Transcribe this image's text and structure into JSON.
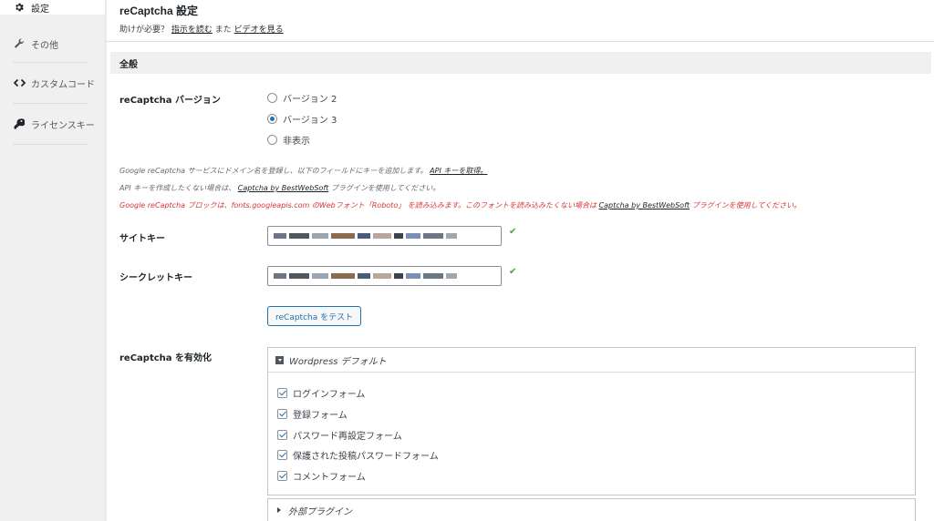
{
  "sidebar": {
    "items": [
      {
        "label": "設定",
        "icon": "gear-icon"
      },
      {
        "label": "その他",
        "icon": "wrench-icon"
      },
      {
        "label": "カスタムコード",
        "icon": "code-icon"
      },
      {
        "label": "ライセンスキー",
        "icon": "key-icon"
      }
    ]
  },
  "header": {
    "title": "reCaptcha 設定",
    "help_prefix": "助けが必要？",
    "help_link1": "指示を読む",
    "help_mid": "また",
    "help_link2": "ビデオを見る"
  },
  "section": {
    "title": "全般"
  },
  "version": {
    "label": "reCaptcha バージョン",
    "options": [
      "バージョン 2",
      "バージョン 3",
      "非表示"
    ],
    "selected": "バージョン 3"
  },
  "notes": {
    "line1_text": "Google reCaptcha サービスにドメイン名を登録し、以下のフィールドにキーを追加します。",
    "line1_link": "API キーを取得。",
    "line2_text": "API キーを作成したくない場合は、",
    "line2_link": "Captcha by BestWebSoft",
    "line2_suffix": "プラグインを使用してください。",
    "line3_text": "Google reCaptcha ブロックは、fonts.googleapis.com のWebフォント「Roboto」 を読み込みます。このフォントを読み込みたくない場合は",
    "line3_link": "Captcha by BestWebSoft",
    "line3_suffix": "プラグインを使用してください。"
  },
  "keys": {
    "site_label": "サイトキー",
    "secret_label": "シークレットキー",
    "check": "✔"
  },
  "test_button": "reCaptcha をテスト",
  "enable": {
    "label": "reCaptcha を有効化",
    "group1_title": "Wordpress デフォルト",
    "group1_items": [
      "ログインフォーム",
      "登録フォーム",
      "パスワード再設定フォーム",
      "保護された投稿パスワードフォーム",
      "コメントフォーム"
    ],
    "group2_title": "外部プラグイン"
  },
  "colors": {
    "accent": "#2271b1",
    "warning": "#d63638",
    "success": "#46a040"
  }
}
